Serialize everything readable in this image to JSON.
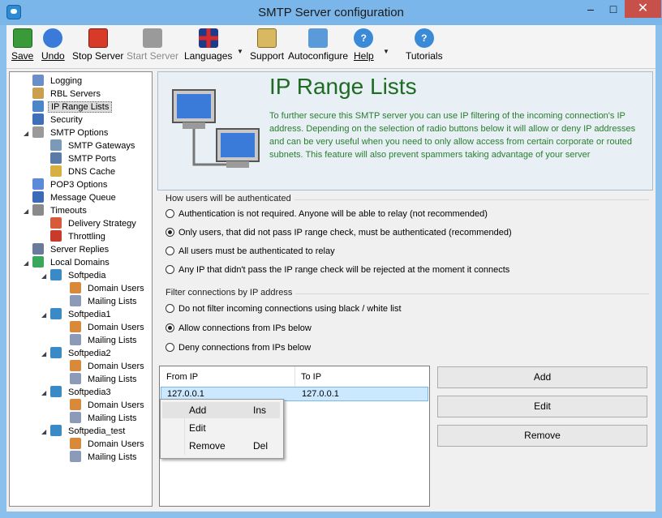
{
  "window": {
    "title": "SMTP Server configuration"
  },
  "toolbar": {
    "save": "Save",
    "undo": "Undo",
    "stop_server": "Stop Server",
    "start_server": "Start Server",
    "languages": "Languages",
    "support": "Support",
    "autoconfigure": "Autoconfigure",
    "help": "Help",
    "tutorials": "Tutorials"
  },
  "icons": {
    "save": "floppy-disk-icon",
    "undo": "undo-arrow-icon",
    "stop_server": "stop-icon",
    "start_server": "film-clapper-icon",
    "languages": "uk-flag-icon",
    "support": "support-envelope-icon",
    "autoconfigure": "house-icon",
    "help": "question-icon",
    "tutorials": "question-icon"
  },
  "tree": [
    {
      "label": "Logging",
      "icon": "log-icon",
      "color": "#6a8fc8",
      "level": 1
    },
    {
      "label": "RBL Servers",
      "icon": "rbl-icon",
      "color": "#c8a050",
      "level": 1
    },
    {
      "label": "IP Range Lists",
      "icon": "monitor-icon",
      "color": "#4a86c8",
      "level": 1,
      "selected": true
    },
    {
      "label": "Security",
      "icon": "user-icon",
      "color": "#3f6fb8",
      "level": 1
    },
    {
      "label": "SMTP Options",
      "icon": "settings-icon",
      "color": "#9a9a9a",
      "level": 1,
      "expanded": true
    },
    {
      "label": "SMTP Gateways",
      "icon": "gateway-icon",
      "color": "#7a9ab8",
      "level": 2
    },
    {
      "label": "SMTP Ports",
      "icon": "ports-icon",
      "color": "#5a7aa8",
      "level": 2
    },
    {
      "label": "DNS Cache",
      "icon": "dns-icon",
      "color": "#d6b040",
      "level": 2
    },
    {
      "label": "POP3 Options",
      "icon": "pop3-icon",
      "color": "#5a8ad8",
      "level": 1
    },
    {
      "label": "Message Queue",
      "icon": "queue-icon",
      "color": "#3a6ab8",
      "level": 1
    },
    {
      "label": "Timeouts",
      "icon": "timeouts-icon",
      "color": "#8a8a8a",
      "level": 1,
      "expanded": true
    },
    {
      "label": "Delivery Strategy",
      "icon": "calendar-icon",
      "color": "#d85a3a",
      "level": 2
    },
    {
      "label": "Throttling",
      "icon": "traffic-light-icon",
      "color": "#c83a2a",
      "level": 2
    },
    {
      "label": "Server Replies",
      "icon": "server-icon",
      "color": "#6a7a9a",
      "level": 1
    },
    {
      "label": "Local Domains",
      "icon": "globe-icon",
      "color": "#3aa85a",
      "level": 1,
      "expanded": true
    },
    {
      "label": "Softpedia",
      "icon": "globe-icon",
      "color": "#3a8ac8",
      "level": 2,
      "expanded": true
    },
    {
      "label": "Domain Users",
      "icon": "users-icon",
      "color": "#d88a3a",
      "level": 3
    },
    {
      "label": "Mailing Lists",
      "icon": "list-icon",
      "color": "#8a9ab8",
      "level": 3
    },
    {
      "label": "Softpedia1",
      "icon": "globe-icon",
      "color": "#3a8ac8",
      "level": 2,
      "expanded": true
    },
    {
      "label": "Domain Users",
      "icon": "users-icon",
      "color": "#d88a3a",
      "level": 3
    },
    {
      "label": "Mailing Lists",
      "icon": "list-icon",
      "color": "#8a9ab8",
      "level": 3
    },
    {
      "label": "Softpedia2",
      "icon": "globe-icon",
      "color": "#3a8ac8",
      "level": 2,
      "expanded": true
    },
    {
      "label": "Domain Users",
      "icon": "users-icon",
      "color": "#d88a3a",
      "level": 3
    },
    {
      "label": "Mailing Lists",
      "icon": "list-icon",
      "color": "#8a9ab8",
      "level": 3
    },
    {
      "label": "Softpedia3",
      "icon": "globe-icon",
      "color": "#3a8ac8",
      "level": 2,
      "expanded": true
    },
    {
      "label": "Domain Users",
      "icon": "users-icon",
      "color": "#d88a3a",
      "level": 3
    },
    {
      "label": "Mailing Lists",
      "icon": "list-icon",
      "color": "#8a9ab8",
      "level": 3
    },
    {
      "label": "Softpedia_test",
      "icon": "globe-icon",
      "color": "#3a8ac8",
      "level": 2,
      "expanded": true
    },
    {
      "label": "Domain Users",
      "icon": "users-icon",
      "color": "#d88a3a",
      "level": 3
    },
    {
      "label": "Mailing Lists",
      "icon": "list-icon",
      "color": "#8a9ab8",
      "level": 3
    }
  ],
  "banner": {
    "title": "IP Range Lists",
    "description": "To further secure this SMTP server you can use IP filtering of the incoming connection's IP address. Depending on the selection of radio buttons below it will allow or deny IP addresses and can be very useful when you need to only allow access from certain corporate or routed subnets. This feature will also prevent spammers taking advantage of your server"
  },
  "auth_group": {
    "label": "How users will be authenticated",
    "options": [
      {
        "label": "Authentication is not required. Anyone will be able to relay (not recommended)",
        "checked": false
      },
      {
        "label": "Only users, that did not pass IP range check, must be authenticated (recommended)",
        "checked": true
      },
      {
        "label": "All users must be authenticated to relay",
        "checked": false
      },
      {
        "label": "Any IP that didn't pass the IP range check will be rejected at the moment it connects",
        "checked": false
      }
    ]
  },
  "filter_group": {
    "label": "Filter connections by IP address",
    "options": [
      {
        "label": "Do not filter incoming connections using black / white list",
        "checked": false
      },
      {
        "label": "Allow connections from IPs below",
        "checked": true
      },
      {
        "label": "Deny connections from IPs below",
        "checked": false
      }
    ]
  },
  "ip_list": {
    "columns": [
      "From IP",
      "To IP"
    ],
    "rows": [
      [
        "127.0.0.1",
        "127.0.0.1"
      ]
    ]
  },
  "buttons": {
    "add": "Add",
    "edit": "Edit",
    "remove": "Remove"
  },
  "context_menu": [
    {
      "label": "Add",
      "shortcut": "Ins"
    },
    {
      "label": "Edit",
      "shortcut": ""
    },
    {
      "label": "Remove",
      "shortcut": "Del"
    }
  ]
}
